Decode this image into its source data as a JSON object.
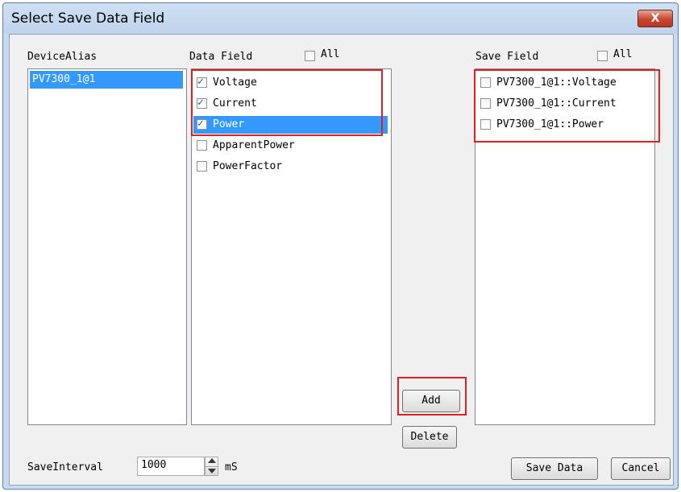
{
  "window": {
    "title": "Select Save Data Field",
    "close_label": "X"
  },
  "device_panel": {
    "header": "DeviceAlias",
    "items": [
      {
        "label": "PV7300_1@1",
        "selected": true
      }
    ]
  },
  "data_panel": {
    "header": "Data Field",
    "all_label": "All",
    "items": [
      {
        "label": "Voltage",
        "checked": true
      },
      {
        "label": "Current",
        "checked": true
      },
      {
        "label": "Power",
        "checked": true,
        "selected": true
      },
      {
        "label": "ApparentPower",
        "checked": false
      },
      {
        "label": "PowerFactor",
        "checked": false
      }
    ]
  },
  "save_panel": {
    "header": "Save Field",
    "all_label": "All",
    "items": [
      {
        "label": "PV7300_1@1::Voltage",
        "checked": false
      },
      {
        "label": "PV7300_1@1::Current",
        "checked": false
      },
      {
        "label": "PV7300_1@1::Power",
        "checked": false
      }
    ]
  },
  "buttons": {
    "add": "Add",
    "delete": "Delete",
    "save_data": "Save Data",
    "cancel": "Cancel"
  },
  "interval": {
    "label": "SaveInterval",
    "value": "1000",
    "unit": "mS"
  },
  "colors": {
    "highlight": "#3399ff",
    "annotation": "#e02020",
    "check": "#2c56a7"
  }
}
